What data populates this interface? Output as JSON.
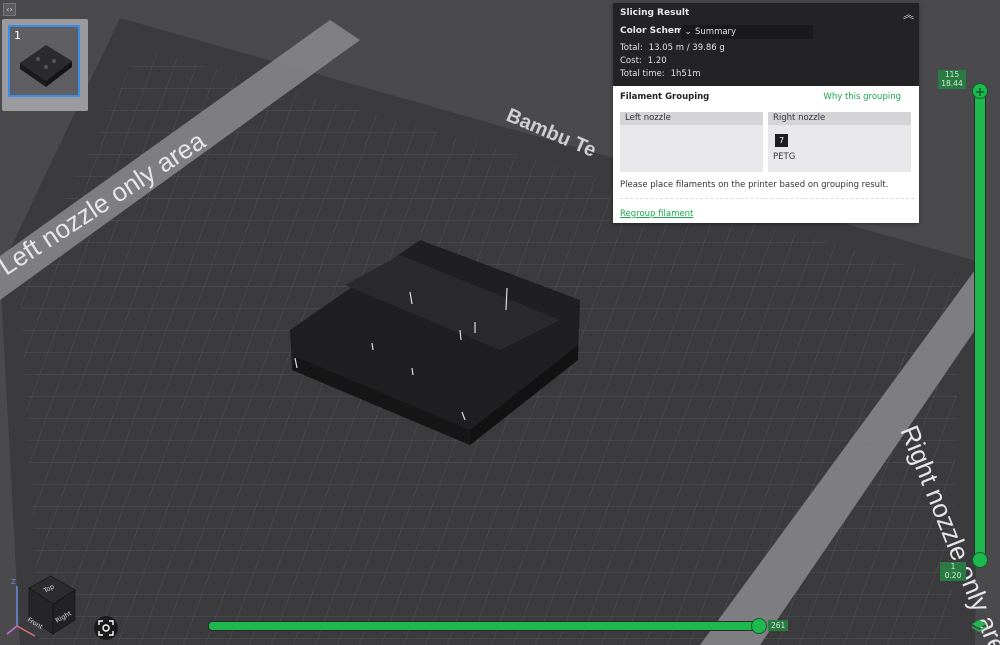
{
  "sidebar": {
    "collapse_icon": "expand-arrows-icon",
    "plates": [
      {
        "number": "1",
        "selected": true
      }
    ]
  },
  "bed": {
    "left_zone_label": "Left nozzle only area",
    "right_zone_label": "Right nozzle only area",
    "brand_text": "Bambu Te"
  },
  "slicing_result": {
    "title": "Slicing Result",
    "color_scheme_label": "Color Scheme",
    "color_scheme_value": "Summary",
    "total_label": "Total:",
    "total_value": "13.05 m / 39.86 g",
    "cost_label": "Cost:",
    "cost_value": "1.20",
    "time_label": "Total time:",
    "time_value": "1h51m"
  },
  "filament_grouping": {
    "title": "Filament Grouping",
    "why_link": "Why this grouping",
    "left_nozzle_label": "Left nozzle",
    "right_nozzle_label": "Right nozzle",
    "right_filament_number": "7",
    "right_filament_name": "PETG",
    "note": "Please place filaments on the printer based on grouping result.",
    "regroup_link": "Regroup filament"
  },
  "layer_slider": {
    "top_layer": "115",
    "top_height": "18.44",
    "bottom_layer": "1",
    "bottom_height": "0.20",
    "accent": "#1eb84f"
  },
  "move_slider": {
    "value": "261"
  },
  "nav_cube": {
    "top": "Top",
    "front": "Front",
    "right": "Right",
    "axis_z": "Z",
    "axis_y": "Y",
    "axis_x": "X"
  }
}
